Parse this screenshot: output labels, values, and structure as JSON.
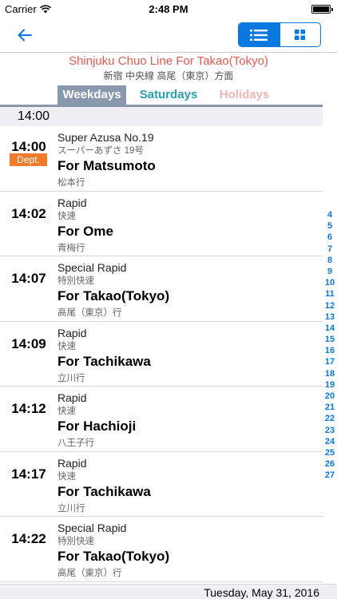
{
  "status_bar": {
    "carrier": "Carrier",
    "time": "2:48 PM"
  },
  "nav": {
    "back_icon": "back-arrow-icon",
    "view_modes": [
      "list-icon",
      "grid-icon"
    ],
    "selected_view": "list"
  },
  "header": {
    "title": "Shinjuku Chuo Line For Takao(Tokyo)",
    "subtitle": "新宿 中央線 高尾（東京）方面"
  },
  "day_tabs": [
    {
      "label": "Weekdays",
      "selected": true
    },
    {
      "label": "Saturdays",
      "selected": false
    },
    {
      "label": "Holidays",
      "selected": false
    }
  ],
  "hour_header": "14:00",
  "rows": [
    {
      "time": "14:00",
      "badge": "Dept.",
      "type": "Super Azusa No.19",
      "type_jp": "スーパーあずさ 19号",
      "dest": "For Matsumoto",
      "dest_jp": "松本行"
    },
    {
      "time": "14:02",
      "type": "Rapid",
      "type_jp": "快速",
      "dest": "For Ome",
      "dest_jp": "青梅行"
    },
    {
      "time": "14:07",
      "type": "Special Rapid",
      "type_jp": "特別快速",
      "dest": "For Takao(Tokyo)",
      "dest_jp": "高尾（東京）行"
    },
    {
      "time": "14:09",
      "type": "Rapid",
      "type_jp": "快速",
      "dest": "For Tachikawa",
      "dest_jp": "立川行"
    },
    {
      "time": "14:12",
      "type": "Rapid",
      "type_jp": "快速",
      "dest": "For Hachioji",
      "dest_jp": "八王子行"
    },
    {
      "time": "14:17",
      "type": "Rapid",
      "type_jp": "快速",
      "dest": "For Tachikawa",
      "dest_jp": "立川行"
    },
    {
      "time": "14:22",
      "type": "Special Rapid",
      "type_jp": "特別快速",
      "dest": "For Takao(Tokyo)",
      "dest_jp": "高尾（東京）行"
    }
  ],
  "hour_index": [
    "4",
    "5",
    "6",
    "7",
    "8",
    "9",
    "10",
    "11",
    "12",
    "13",
    "14",
    "15",
    "16",
    "17",
    "18",
    "19",
    "20",
    "21",
    "22",
    "23",
    "24",
    "25",
    "26",
    "27"
  ],
  "footer": {
    "date": "Tuesday, May 31, 2016"
  },
  "colors": {
    "accent": "#0a79df",
    "title": "#e8594f",
    "weekdays_tab": "#8a98ad",
    "saturdays": "#2a9db1",
    "holidays": "#f1b3b3",
    "dept_badge": "#ef7b2b"
  }
}
